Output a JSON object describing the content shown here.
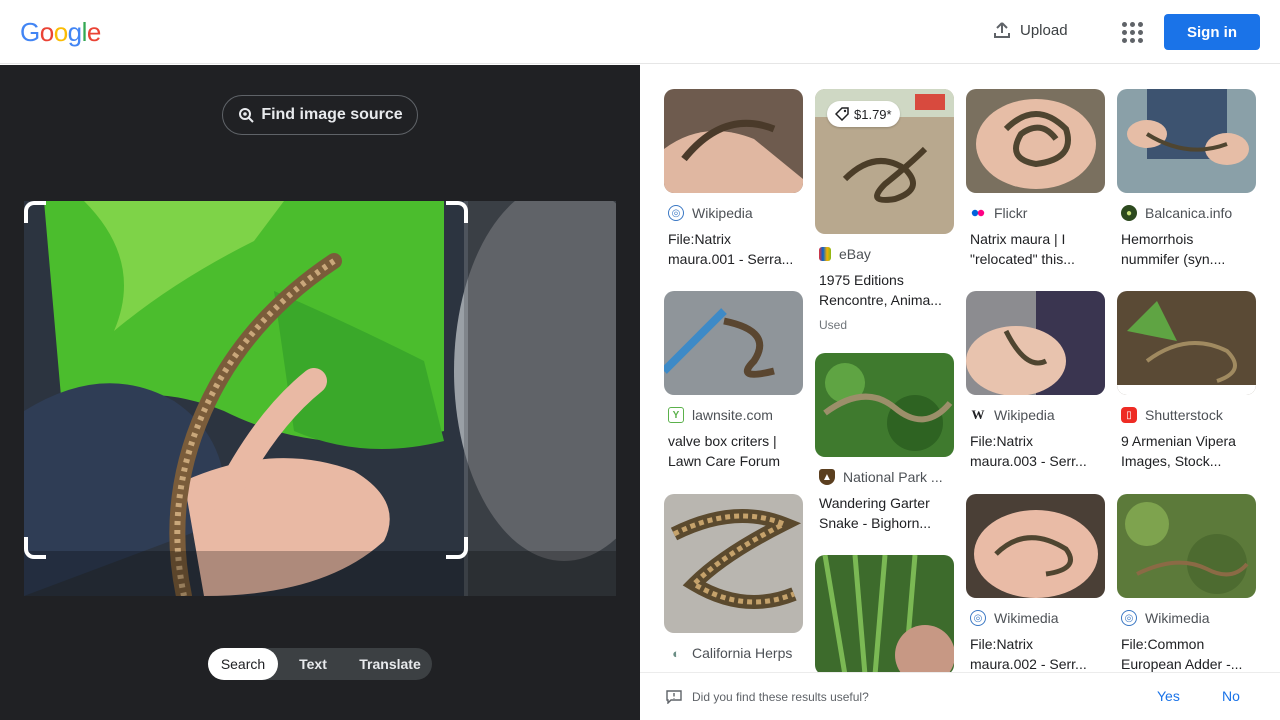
{
  "header": {
    "logo_letters": [
      "G",
      "o",
      "o",
      "g",
      "l",
      "e"
    ],
    "logo_colors": [
      "#4285F4",
      "#EA4335",
      "#FBBC05",
      "#4285F4",
      "#34A853",
      "#EA4335"
    ],
    "upload_label": "Upload",
    "signin_label": "Sign in"
  },
  "left": {
    "find_source_label": "Find image source",
    "modes": [
      "Search",
      "Text",
      "Translate"
    ],
    "active_mode": "Search"
  },
  "results": [
    {
      "source": "Wikipedia",
      "title_lines": [
        "File:Natrix",
        "maura.001 - Serra..."
      ],
      "favicon": "wikipedia-icon"
    },
    {
      "source": "eBay",
      "title_lines": [
        "1975 Editions",
        "Rencontre, Anima..."
      ],
      "price": "$1.79*",
      "meta": "Used",
      "favicon": "ebay-icon"
    },
    {
      "source": "Flickr",
      "title_lines": [
        "Natrix maura | I",
        "\"relocated\" this..."
      ],
      "favicon": "flickr-icon"
    },
    {
      "source": "Balcanica.info",
      "title_lines": [
        "Hemorrhois",
        "nummifer (syn...."
      ],
      "favicon": "balcanica-icon"
    },
    {
      "source": "lawnsite.com",
      "title_lines": [
        "valve box criters |",
        "Lawn Care Forum"
      ],
      "favicon": "lawnsite-icon"
    },
    {
      "source": "National Park ...",
      "title_lines": [
        "Wandering Garter",
        "Snake - Bighorn..."
      ],
      "favicon": "nps-icon"
    },
    {
      "source": "Wikipedia",
      "title_lines": [
        "File:Natrix",
        "maura.003 - Serr..."
      ],
      "favicon": "wikipedia-w-icon"
    },
    {
      "source": "Shutterstock",
      "title_lines": [
        "9 Armenian Vipera",
        "Images, Stock..."
      ],
      "favicon": "shutterstock-icon"
    },
    {
      "source": "California Herps",
      "title_lines": [],
      "favicon": "calherps-icon"
    },
    {
      "source": "Wikimedia",
      "title_lines": [
        "File:Natrix",
        "maura.002 - Serr..."
      ],
      "favicon": "wikimedia-icon"
    },
    {
      "source": "Wikimedia",
      "title_lines": [
        "File:Common",
        "European Adder -..."
      ],
      "favicon": "wikimedia-icon"
    }
  ],
  "feedback": {
    "question": "Did you find these results useful?",
    "yes_label": "Yes",
    "no_label": "No"
  },
  "colors": {
    "accent": "#1a73e8",
    "left_bg": "#202124"
  }
}
